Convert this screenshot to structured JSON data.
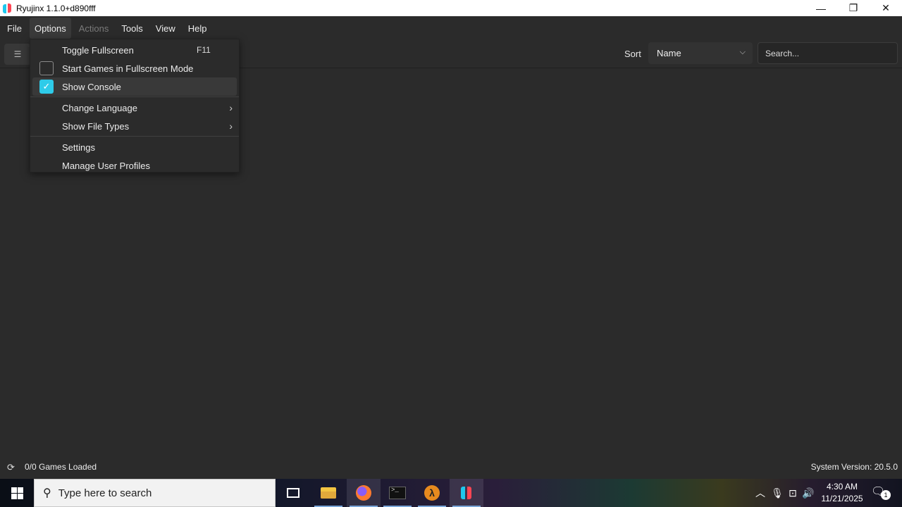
{
  "window": {
    "title": "Ryujinx 1.1.0+d890fff",
    "minimize_icon": "—",
    "restore_icon": "❐",
    "close_icon": "✕"
  },
  "menubar": {
    "items": [
      "File",
      "Options",
      "Actions",
      "Tools",
      "View",
      "Help"
    ]
  },
  "options_menu": {
    "toggle_fullscreen": "Toggle Fullscreen",
    "toggle_fullscreen_shortcut": "F11",
    "start_fullscreen": "Start Games in Fullscreen Mode",
    "start_fullscreen_checked": false,
    "show_console": "Show Console",
    "show_console_checked": true,
    "change_language": "Change Language",
    "show_file_types": "Show File Types",
    "settings": "Settings",
    "manage_user_profiles": "Manage User Profiles"
  },
  "toolbar": {
    "sort_label": "Sort",
    "sort_value": "Name",
    "search_placeholder": "Search..."
  },
  "statusbar": {
    "games_loaded": "0/0 Games Loaded",
    "system_version": "System Version: 20.5.0"
  },
  "taskbar": {
    "search_placeholder": "Type here to search",
    "time": "4:30 AM",
    "date": "11/21/2025",
    "notification_count": "1"
  },
  "colors": {
    "accent": "#2ecbe9",
    "background": "#2b2b2b",
    "logo_blue": "#1ec8ee",
    "logo_red": "#ff4554"
  }
}
